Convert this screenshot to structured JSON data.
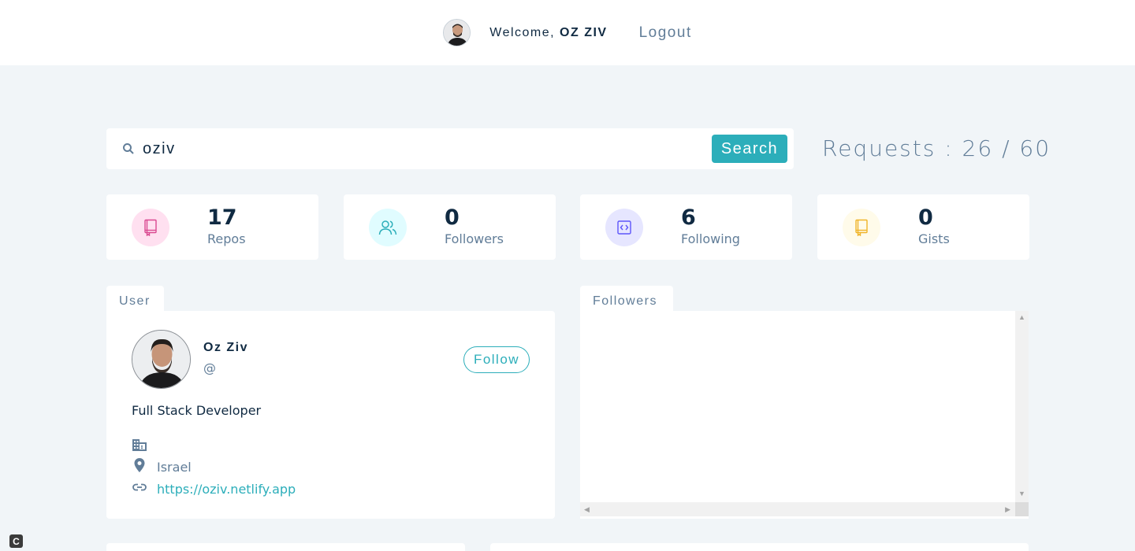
{
  "nav": {
    "welcome_prefix": "Welcome, ",
    "user_name": "OZ ZIV",
    "logout_label": "Logout"
  },
  "search": {
    "value": "oziv",
    "button_label": "Search"
  },
  "requests": {
    "text": "Requests : 26 / 60"
  },
  "stats": [
    {
      "value": "17",
      "label": "Repos",
      "icon": "repo-book-icon",
      "color": "#da4a91",
      "bg": "#ffe0f0"
    },
    {
      "value": "0",
      "label": "Followers",
      "icon": "users-icon",
      "color": "#2caeba",
      "bg": "#e0fcff"
    },
    {
      "value": "6",
      "label": "Following",
      "icon": "code-icon",
      "color": "#5d55fa",
      "bg": "#e6e6ff"
    },
    {
      "value": "0",
      "label": "Gists",
      "icon": "gist-book-icon",
      "color": "#f0b429",
      "bg": "#fffbea"
    }
  ],
  "user_tab": {
    "label": "User"
  },
  "followers_tab": {
    "label": "Followers"
  },
  "user": {
    "name": "Oz Ziv",
    "handle": "@",
    "follow_label": "Follow",
    "bio": "Full Stack Developer",
    "company": "",
    "location": "Israel",
    "blog": "https://oziv.netlify.app"
  },
  "badge": {
    "text": "C"
  },
  "colors": {
    "accent": "#2caeba",
    "background": "#f1f5f8",
    "text_dark": "#102a42",
    "text_muted": "#617d98"
  }
}
